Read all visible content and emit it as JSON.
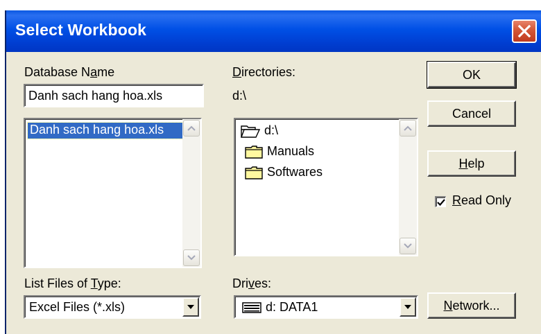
{
  "window": {
    "title": "Select Workbook"
  },
  "database": {
    "label_pre": "Database N",
    "label_mnemonic": "a",
    "label_post": "me",
    "value": "Danh sach hang hoa.xls",
    "list_items": [
      "Danh sach hang hoa.xls"
    ]
  },
  "directories": {
    "label_pre": "",
    "label_mnemonic": "D",
    "label_post": "irectories:",
    "current_path": "d:\\",
    "items": [
      {
        "name": "d:\\",
        "icon": "open-folder-icon"
      },
      {
        "name": "Manuals",
        "icon": "folder-icon"
      },
      {
        "name": "Softwares",
        "icon": "folder-icon"
      }
    ]
  },
  "file_type": {
    "label_pre": "List Files of ",
    "label_mnemonic": "T",
    "label_post": "ype:",
    "selected": "Excel Files (*.xls)"
  },
  "drives": {
    "label_pre": "Dri",
    "label_mnemonic": "v",
    "label_post": "es:",
    "selected": "d: DATA1",
    "icon": "drive-icon"
  },
  "buttons": {
    "ok": "OK",
    "cancel": "Cancel",
    "help_mnemonic": "H",
    "help_post": "elp",
    "network_mnemonic": "N",
    "network_post": "etwork..."
  },
  "read_only": {
    "checked": true,
    "label_mnemonic": "R",
    "label_post": "ead Only"
  },
  "colors": {
    "titlebar": "#0054e3",
    "selection": "#316ac5",
    "dialog_bg": "#ece9d8",
    "close_button": "#d55a3a"
  }
}
